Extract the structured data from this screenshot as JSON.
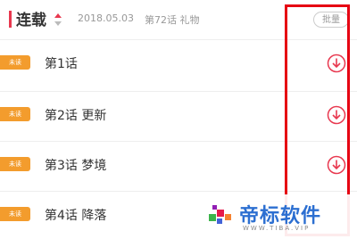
{
  "header": {
    "title": "连载",
    "date": "2018.05.03",
    "latest": "第72话 礼物",
    "batch_label": "批量"
  },
  "chapters": [
    {
      "badge": "未读",
      "label": "第1话"
    },
    {
      "badge": "未读",
      "label": "第2话 更新"
    },
    {
      "badge": "未读",
      "label": "第3话 梦境"
    },
    {
      "badge": "未读",
      "label": "第4话 降落"
    }
  ],
  "watermark": {
    "text": "帝标软件",
    "url": "WWW.TIBA.VIP"
  },
  "colors": {
    "accent": "#e8384f",
    "badge": "#f39c2d",
    "highlight": "#e60012"
  }
}
